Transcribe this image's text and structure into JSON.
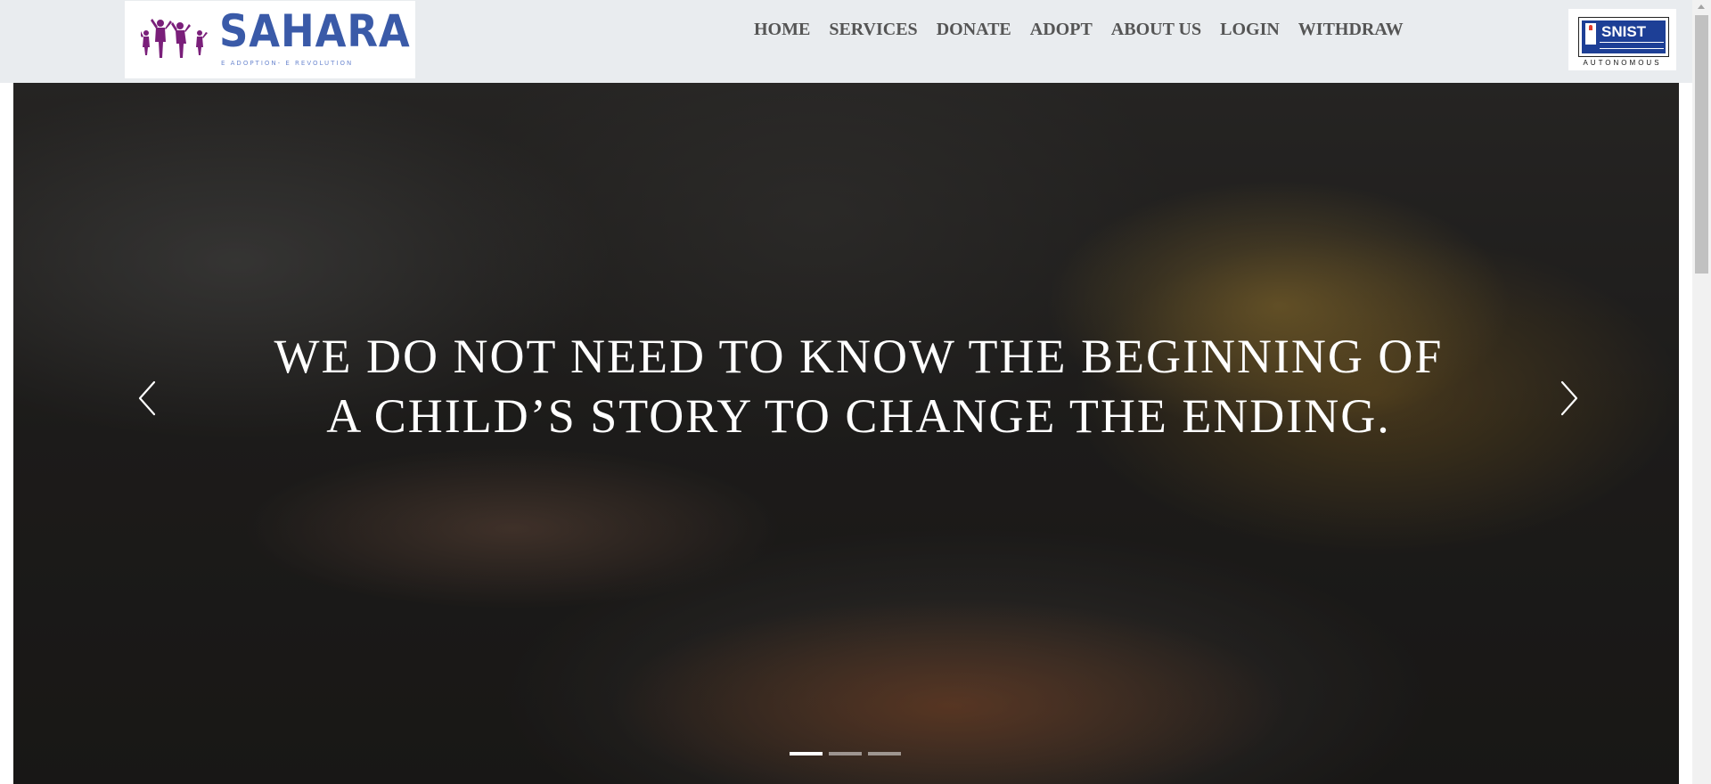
{
  "brand": {
    "name": "SAHARA",
    "tagline": "E ADOPTION- E REVOLUTION",
    "figure_color": "#7a1f7a",
    "name_color": "#3a5aa8"
  },
  "nav": {
    "items": [
      {
        "label": "HOME"
      },
      {
        "label": "SERVICES"
      },
      {
        "label": "DONATE"
      },
      {
        "label": "ADOPT"
      },
      {
        "label": "ABOUT US"
      },
      {
        "label": "LOGIN"
      },
      {
        "label": "WITHDRAW"
      }
    ]
  },
  "partner": {
    "name": "SNIST",
    "status": "AUTONOMOUS"
  },
  "hero": {
    "caption": "WE DO NOT NEED TO KNOW THE BEGINNING OF A CHILD’S STORY TO CHANGE THE ENDING.",
    "prev_icon": "chevron-left-icon",
    "next_icon": "chevron-right-icon",
    "slide_count": 3,
    "active_slide": 1
  }
}
